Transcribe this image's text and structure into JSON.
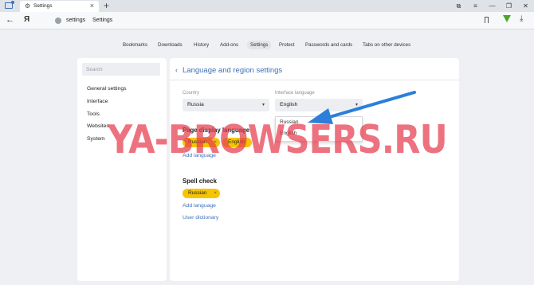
{
  "tab": {
    "title": "Settings",
    "icon": "gear-icon"
  },
  "addressbar": {
    "logo": "Я",
    "url": "settings",
    "page_title": "Settings"
  },
  "settings_nav": [
    {
      "label": "Bookmarks"
    },
    {
      "label": "Downloads"
    },
    {
      "label": "History"
    },
    {
      "label": "Add-ons"
    },
    {
      "label": "Settings",
      "active": true
    },
    {
      "label": "Protect"
    },
    {
      "label": "Passwords and cards"
    },
    {
      "label": "Tabs on other devices"
    }
  ],
  "sidebar": {
    "search_placeholder": "Search",
    "items": [
      {
        "label": "General settings"
      },
      {
        "label": "Interface"
      },
      {
        "label": "Tools"
      },
      {
        "label": "Websites"
      },
      {
        "label": "System"
      }
    ]
  },
  "main": {
    "title": "Language and region settings",
    "country": {
      "label": "Country",
      "value": "Russia"
    },
    "interface_language": {
      "label": "Interface language",
      "value": "English",
      "options": [
        "Russian",
        "English"
      ]
    },
    "page_display": {
      "title": "Page display language",
      "chips": [
        "Russian",
        "English"
      ],
      "add_link": "Add language"
    },
    "spell_check": {
      "title": "Spell check",
      "chips": [
        "Russian"
      ],
      "add_link": "Add language",
      "dictionary_link": "User dictionary"
    }
  },
  "watermark": "YA-BROWSERS.RU",
  "colors": {
    "accent": "#3d6fb8",
    "chip": "#f7c400",
    "watermark": "#e63c4e",
    "arrow": "#2b7fd9"
  }
}
